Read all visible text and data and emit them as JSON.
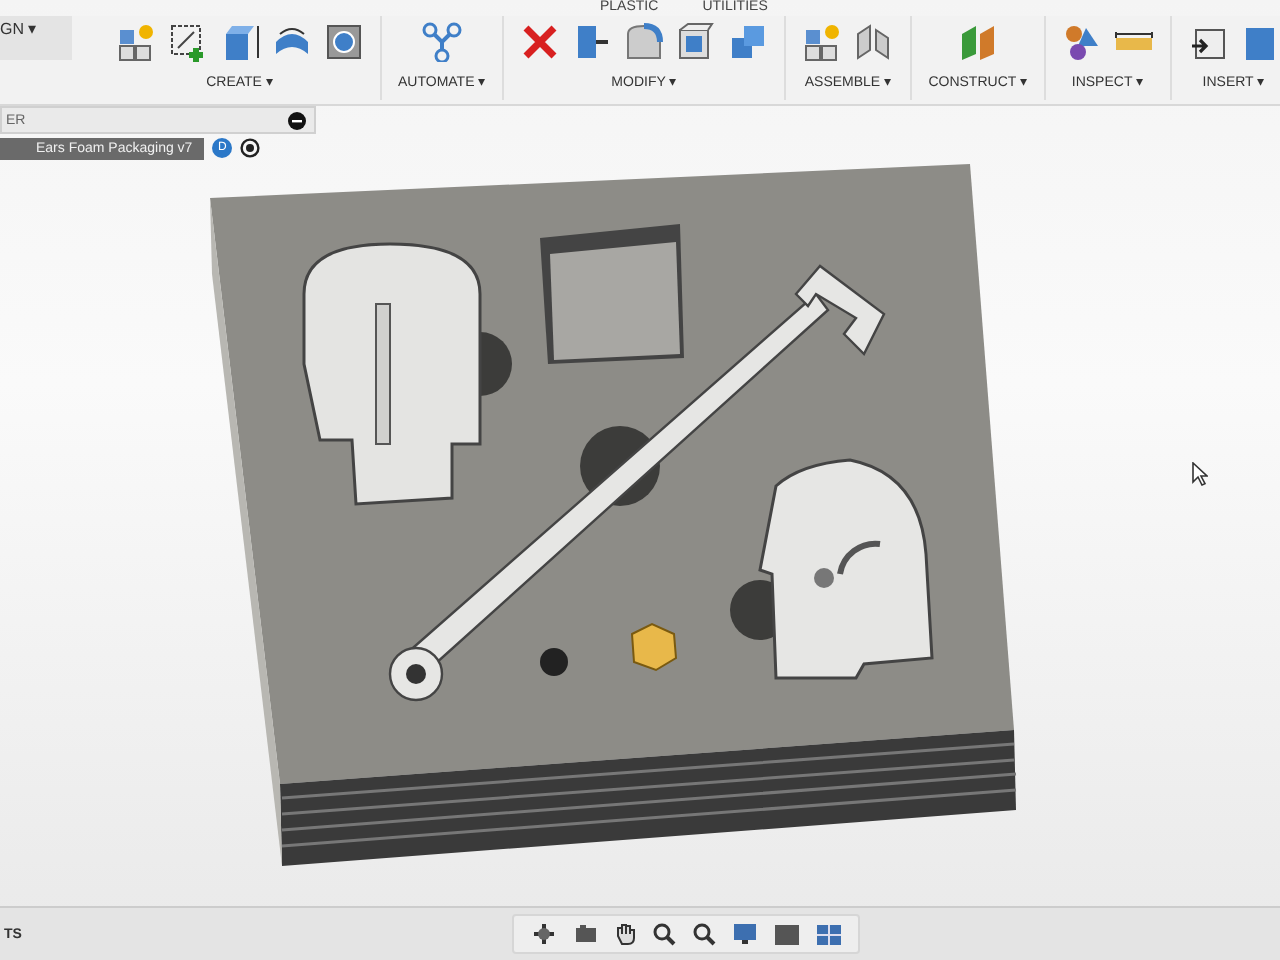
{
  "workspace_menu": {
    "label": "GN ▾"
  },
  "toolbar_tabs": [
    {
      "label": "PLASTIC",
      "selected": false
    },
    {
      "label": "UTILITIES",
      "selected": false
    }
  ],
  "toolbar_groups": [
    {
      "kind": "create",
      "label": "CREATE ▾"
    },
    {
      "kind": "automate",
      "label": "AUTOMATE ▾"
    },
    {
      "kind": "modify",
      "label": "MODIFY ▾"
    },
    {
      "kind": "assemble",
      "label": "ASSEMBLE ▾"
    },
    {
      "kind": "construct",
      "label": "CONSTRUCT ▾"
    },
    {
      "kind": "inspect",
      "label": "INSPECT ▾"
    },
    {
      "kind": "insert",
      "label": "INSERT ▾"
    }
  ],
  "browser": {
    "title": "ER"
  },
  "document_tab": {
    "title": "Ears Foam Packaging v7",
    "badge": "D"
  },
  "comments_panel": {
    "title": "TS"
  }
}
